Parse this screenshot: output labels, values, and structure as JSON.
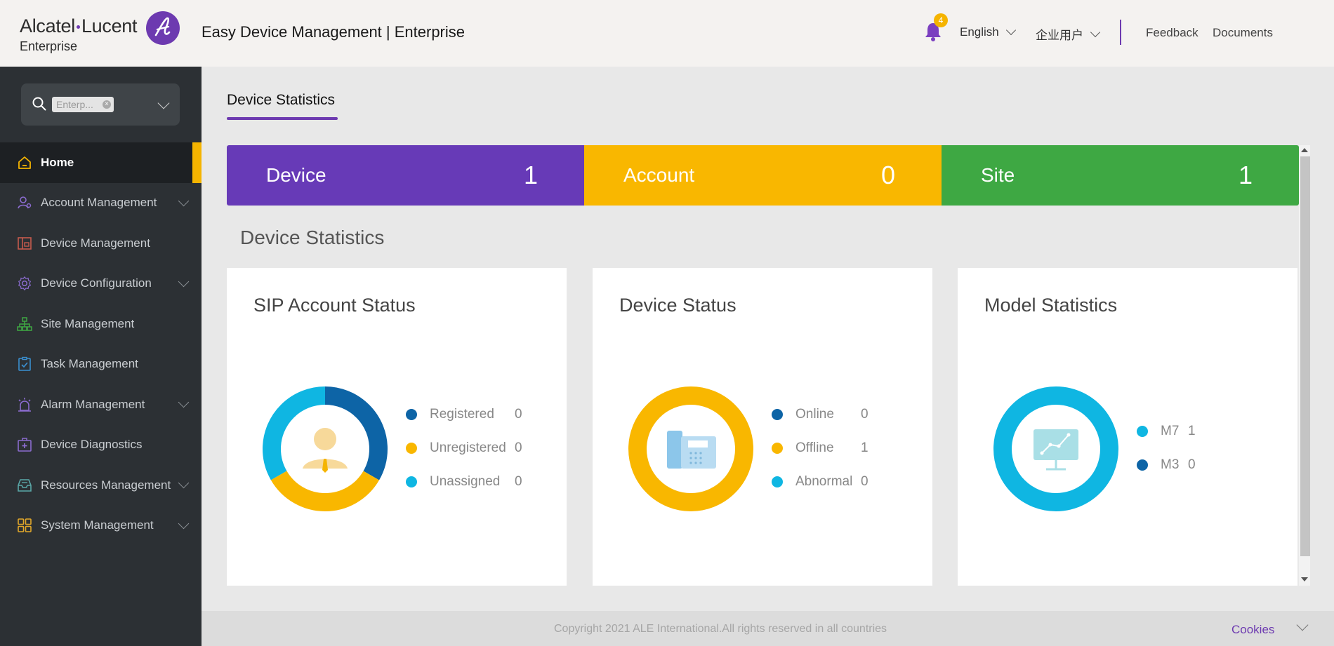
{
  "header": {
    "brand_main_1": "Alcatel",
    "brand_main_2": "Lucent",
    "brand_sub": "Enterprise",
    "app_title": "Easy Device Management | Enterprise",
    "notification_count": "4",
    "language": "English",
    "user_type": "企业用户",
    "feedback": "Feedback",
    "documents": "Documents"
  },
  "sidebar": {
    "search_chip": "Enterp...",
    "items": [
      {
        "label": "Home",
        "active": true,
        "expandable": false,
        "icon": "home-icon"
      },
      {
        "label": "Account Management",
        "active": false,
        "expandable": true,
        "icon": "account-icon"
      },
      {
        "label": "Device Management",
        "active": false,
        "expandable": false,
        "icon": "device-icon"
      },
      {
        "label": "Device Configuration",
        "active": false,
        "expandable": true,
        "icon": "gear-icon"
      },
      {
        "label": "Site Management",
        "active": false,
        "expandable": false,
        "icon": "sitemap-icon"
      },
      {
        "label": "Task Management",
        "active": false,
        "expandable": false,
        "icon": "clipboard-check-icon"
      },
      {
        "label": "Alarm Management",
        "active": false,
        "expandable": true,
        "icon": "alarm-icon"
      },
      {
        "label": "Device Diagnostics",
        "active": false,
        "expandable": false,
        "icon": "medical-kit-icon"
      },
      {
        "label": "Resources Management",
        "active": false,
        "expandable": true,
        "icon": "inbox-icon"
      },
      {
        "label": "System Management",
        "active": false,
        "expandable": true,
        "icon": "grid-icon"
      }
    ]
  },
  "main": {
    "tab": "Device Statistics",
    "stats": [
      {
        "label": "Device",
        "value": "1",
        "color": "#673ab7"
      },
      {
        "label": "Account",
        "value": "0",
        "color": "#f9b700"
      },
      {
        "label": "Site",
        "value": "1",
        "color": "#3ea843"
      }
    ],
    "section_title": "Device Statistics",
    "cards": [
      {
        "title": "SIP Account Status",
        "icon": "user-icon",
        "legend": [
          {
            "label": "Registered",
            "value": "0",
            "color": "#0d64a6"
          },
          {
            "label": "Unregistered",
            "value": "0",
            "color": "#f9b700"
          },
          {
            "label": "Unassigned",
            "value": "0",
            "color": "#0fb6e2"
          }
        ]
      },
      {
        "title": "Device Status",
        "icon": "desk-phone-icon",
        "legend": [
          {
            "label": "Online",
            "value": "0",
            "color": "#0d64a6"
          },
          {
            "label": "Offline",
            "value": "1",
            "color": "#f9b700"
          },
          {
            "label": "Abnormal",
            "value": "0",
            "color": "#0fb6e2"
          }
        ]
      },
      {
        "title": "Model Statistics",
        "icon": "monitor-chart-icon",
        "legend": [
          {
            "label": "M7",
            "value": "1",
            "color": "#0fb6e2"
          },
          {
            "label": "M3",
            "value": "0",
            "color": "#0d64a6"
          }
        ]
      }
    ]
  },
  "footer": {
    "copyright": "Copyright 2021 ALE International.All rights reserved in all countries",
    "cookies": "Cookies"
  }
}
